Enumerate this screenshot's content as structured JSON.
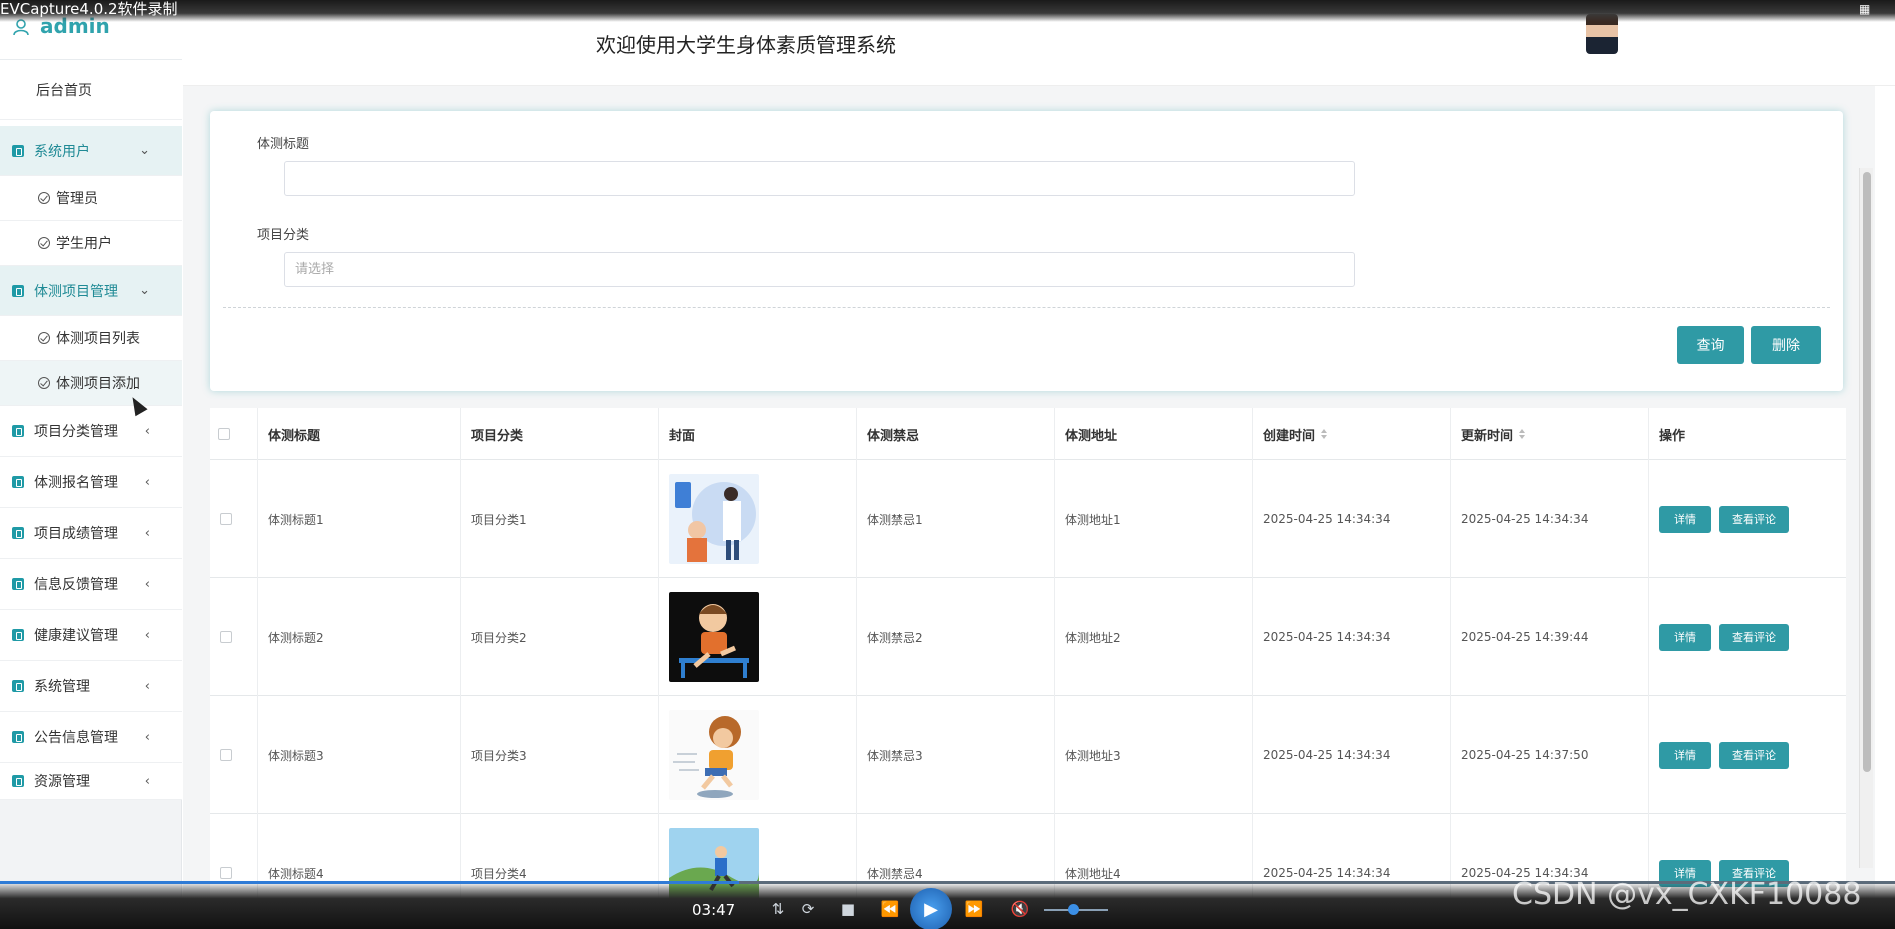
{
  "recorder": {
    "title": "EVCapture4.0.2软件录制"
  },
  "sidebar": {
    "username": "admin",
    "home": "后台首页",
    "groups": [
      {
        "label": "系统用户",
        "open": true,
        "children": [
          "管理员",
          "学生用户"
        ]
      },
      {
        "label": "体测项目管理",
        "open": true,
        "children": [
          "体测项目列表",
          "体测项目添加"
        ]
      },
      {
        "label": "项目分类管理",
        "open": false
      },
      {
        "label": "体测报名管理",
        "open": false
      },
      {
        "label": "项目成绩管理",
        "open": false
      },
      {
        "label": "信息反馈管理",
        "open": false
      },
      {
        "label": "健康建议管理",
        "open": false
      },
      {
        "label": "系统管理",
        "open": false
      },
      {
        "label": "公告信息管理",
        "open": false
      },
      {
        "label": "资源管理",
        "open": false
      }
    ]
  },
  "header": {
    "title": "欢迎使用大学生身体素质管理系统"
  },
  "search": {
    "title_label": "体测标题",
    "title_value": "",
    "category_label": "项目分类",
    "category_placeholder": "请选择",
    "query_button": "查询",
    "delete_button": "删除"
  },
  "table": {
    "columns": [
      "体测标题",
      "项目分类",
      "封面",
      "体测禁忌",
      "体测地址",
      "创建时间",
      "更新时间",
      "操作"
    ],
    "sortable_columns": [
      "创建时间",
      "更新时间"
    ],
    "rows": [
      {
        "title": "体测标题1",
        "category": "项目分类1",
        "cover": "medical-checkup-illustration",
        "taboo": "体测禁忌1",
        "address": "体测地址1",
        "created": "2025-04-25 14:34:34",
        "updated": "2025-04-25 14:34:34"
      },
      {
        "title": "体测标题2",
        "category": "项目分类2",
        "cover": "hurdle-runner-cartoon",
        "taboo": "体测禁忌2",
        "address": "体测地址2",
        "created": "2025-04-25 14:34:34",
        "updated": "2025-04-25 14:39:44"
      },
      {
        "title": "体测标题3",
        "category": "项目分类3",
        "cover": "running-boy-cartoon",
        "taboo": "体测禁忌3",
        "address": "体测地址3",
        "created": "2025-04-25 14:34:34",
        "updated": "2025-04-25 14:37:50"
      },
      {
        "title": "体测标题4",
        "category": "项目分类4",
        "cover": "runner-landscape-illustration",
        "taboo": "体测禁忌4",
        "address": "体测地址4",
        "created": "2025-04-25 14:34:34",
        "updated": "2025-04-25 14:34:34"
      }
    ],
    "row_actions": {
      "detail": "详情",
      "comments": "查看评论"
    }
  },
  "player": {
    "time": "03:47",
    "progress_fraction": 0.39,
    "volume_fraction": 0.45
  },
  "watermark": "CSDN @vx_CXKF10088",
  "colors": {
    "accent": "#2f9aa5",
    "brand_text": "#30a3ad"
  }
}
